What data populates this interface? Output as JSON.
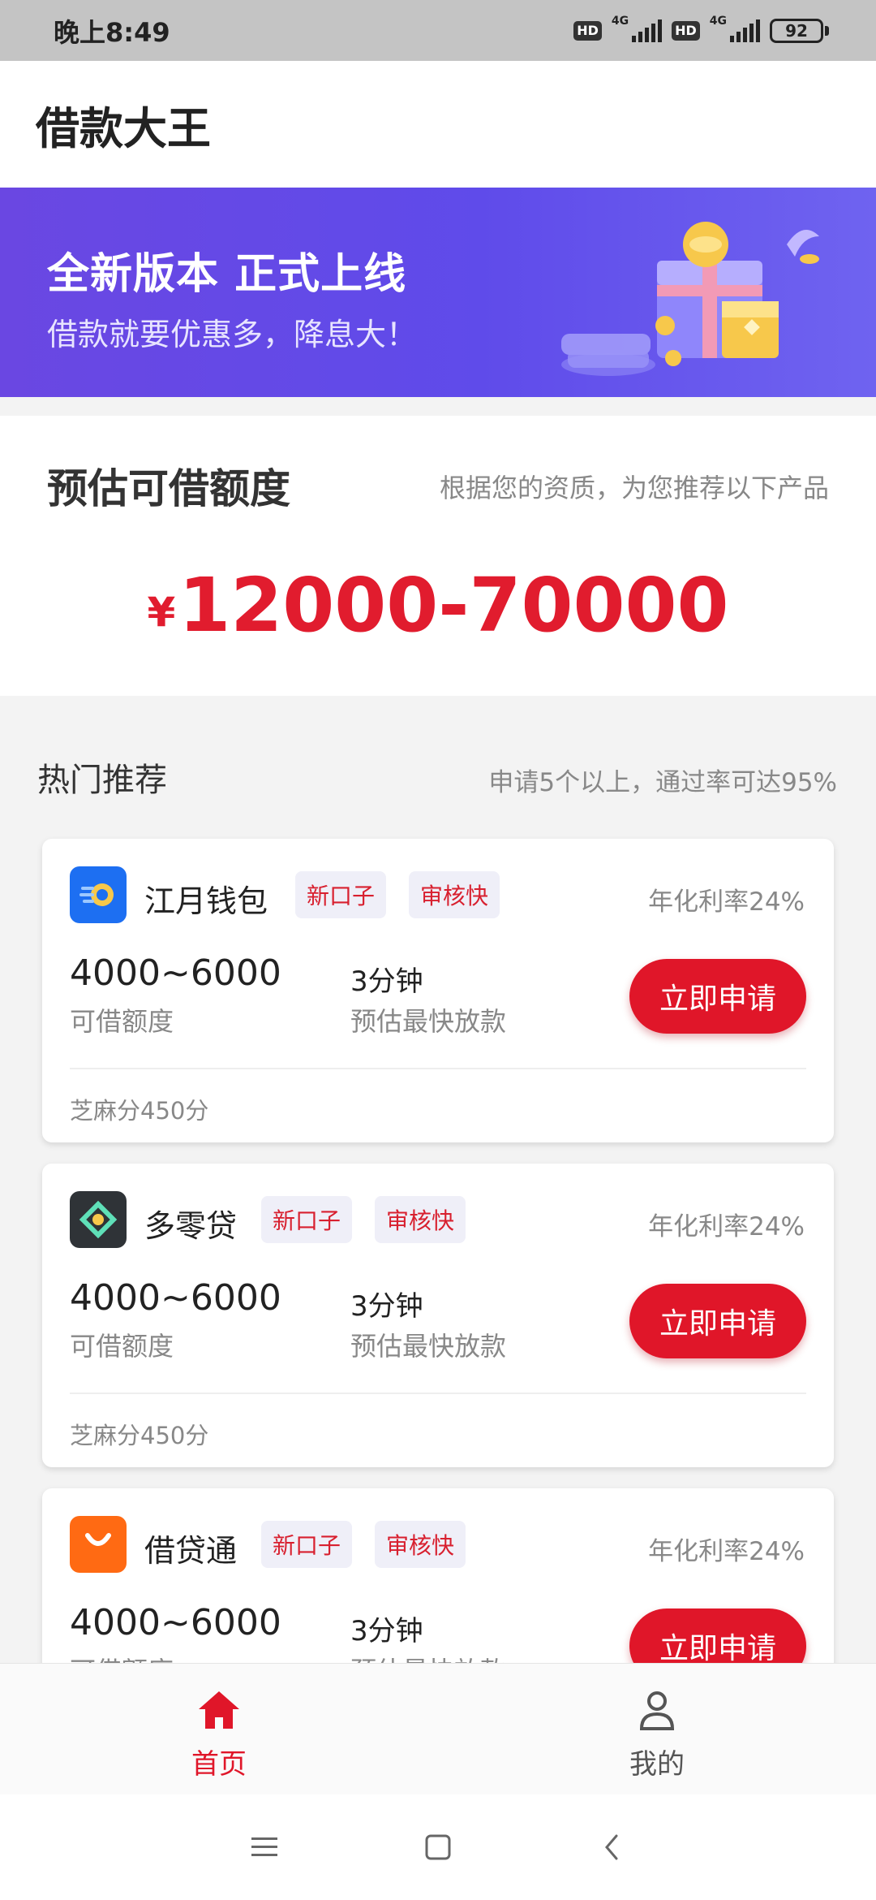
{
  "status_bar": {
    "time": "晚上8:49",
    "hd_label": "HD",
    "network_type": "4G",
    "battery": "92"
  },
  "header": {
    "title": "借款大王"
  },
  "banner": {
    "title": "全新版本  正式上线",
    "subtitle": "借款就要优惠多，降息大！"
  },
  "quota": {
    "title": "预估可借额度",
    "hint": "根据您的资质，为您推荐以下产品",
    "currency": "¥",
    "range": "12000-70000"
  },
  "recommend": {
    "title": "热门推荐",
    "hint": "申请5个以上，通过率可达95%"
  },
  "products": [
    {
      "name": "江月钱包",
      "tags": [
        "新口子",
        "审核快"
      ],
      "rate": "年化利率24%",
      "amount": "4000~6000",
      "amount_label": "可借额度",
      "time": "3分钟",
      "time_label": "预估最快放款",
      "apply_label": "立即申请",
      "credit": "芝麻分450分",
      "logo_color": "#1d6ff2",
      "logo_icon": "coin-speed-icon"
    },
    {
      "name": "多零贷",
      "tags": [
        "新口子",
        "审核快"
      ],
      "rate": "年化利率24%",
      "amount": "4000~6000",
      "amount_label": "可借额度",
      "time": "3分钟",
      "time_label": "预估最快放款",
      "apply_label": "立即申请",
      "credit": "芝麻分450分",
      "logo_color": "#2f3337",
      "logo_icon": "diamond-eye-icon"
    },
    {
      "name": "借贷通",
      "tags": [
        "新口子",
        "审核快"
      ],
      "rate": "年化利率24%",
      "amount": "4000~6000",
      "amount_label": "可借额度",
      "time": "3分钟",
      "time_label": "预估最快放款",
      "apply_label": "立即申请",
      "credit": "",
      "logo_color": "#ff6a13",
      "logo_icon": "shopping-bag-icon"
    }
  ],
  "bottom_nav": {
    "home_label": "首页",
    "mine_label": "我的"
  },
  "colors": {
    "accent": "#e01629",
    "banner": "#5f4bea"
  }
}
